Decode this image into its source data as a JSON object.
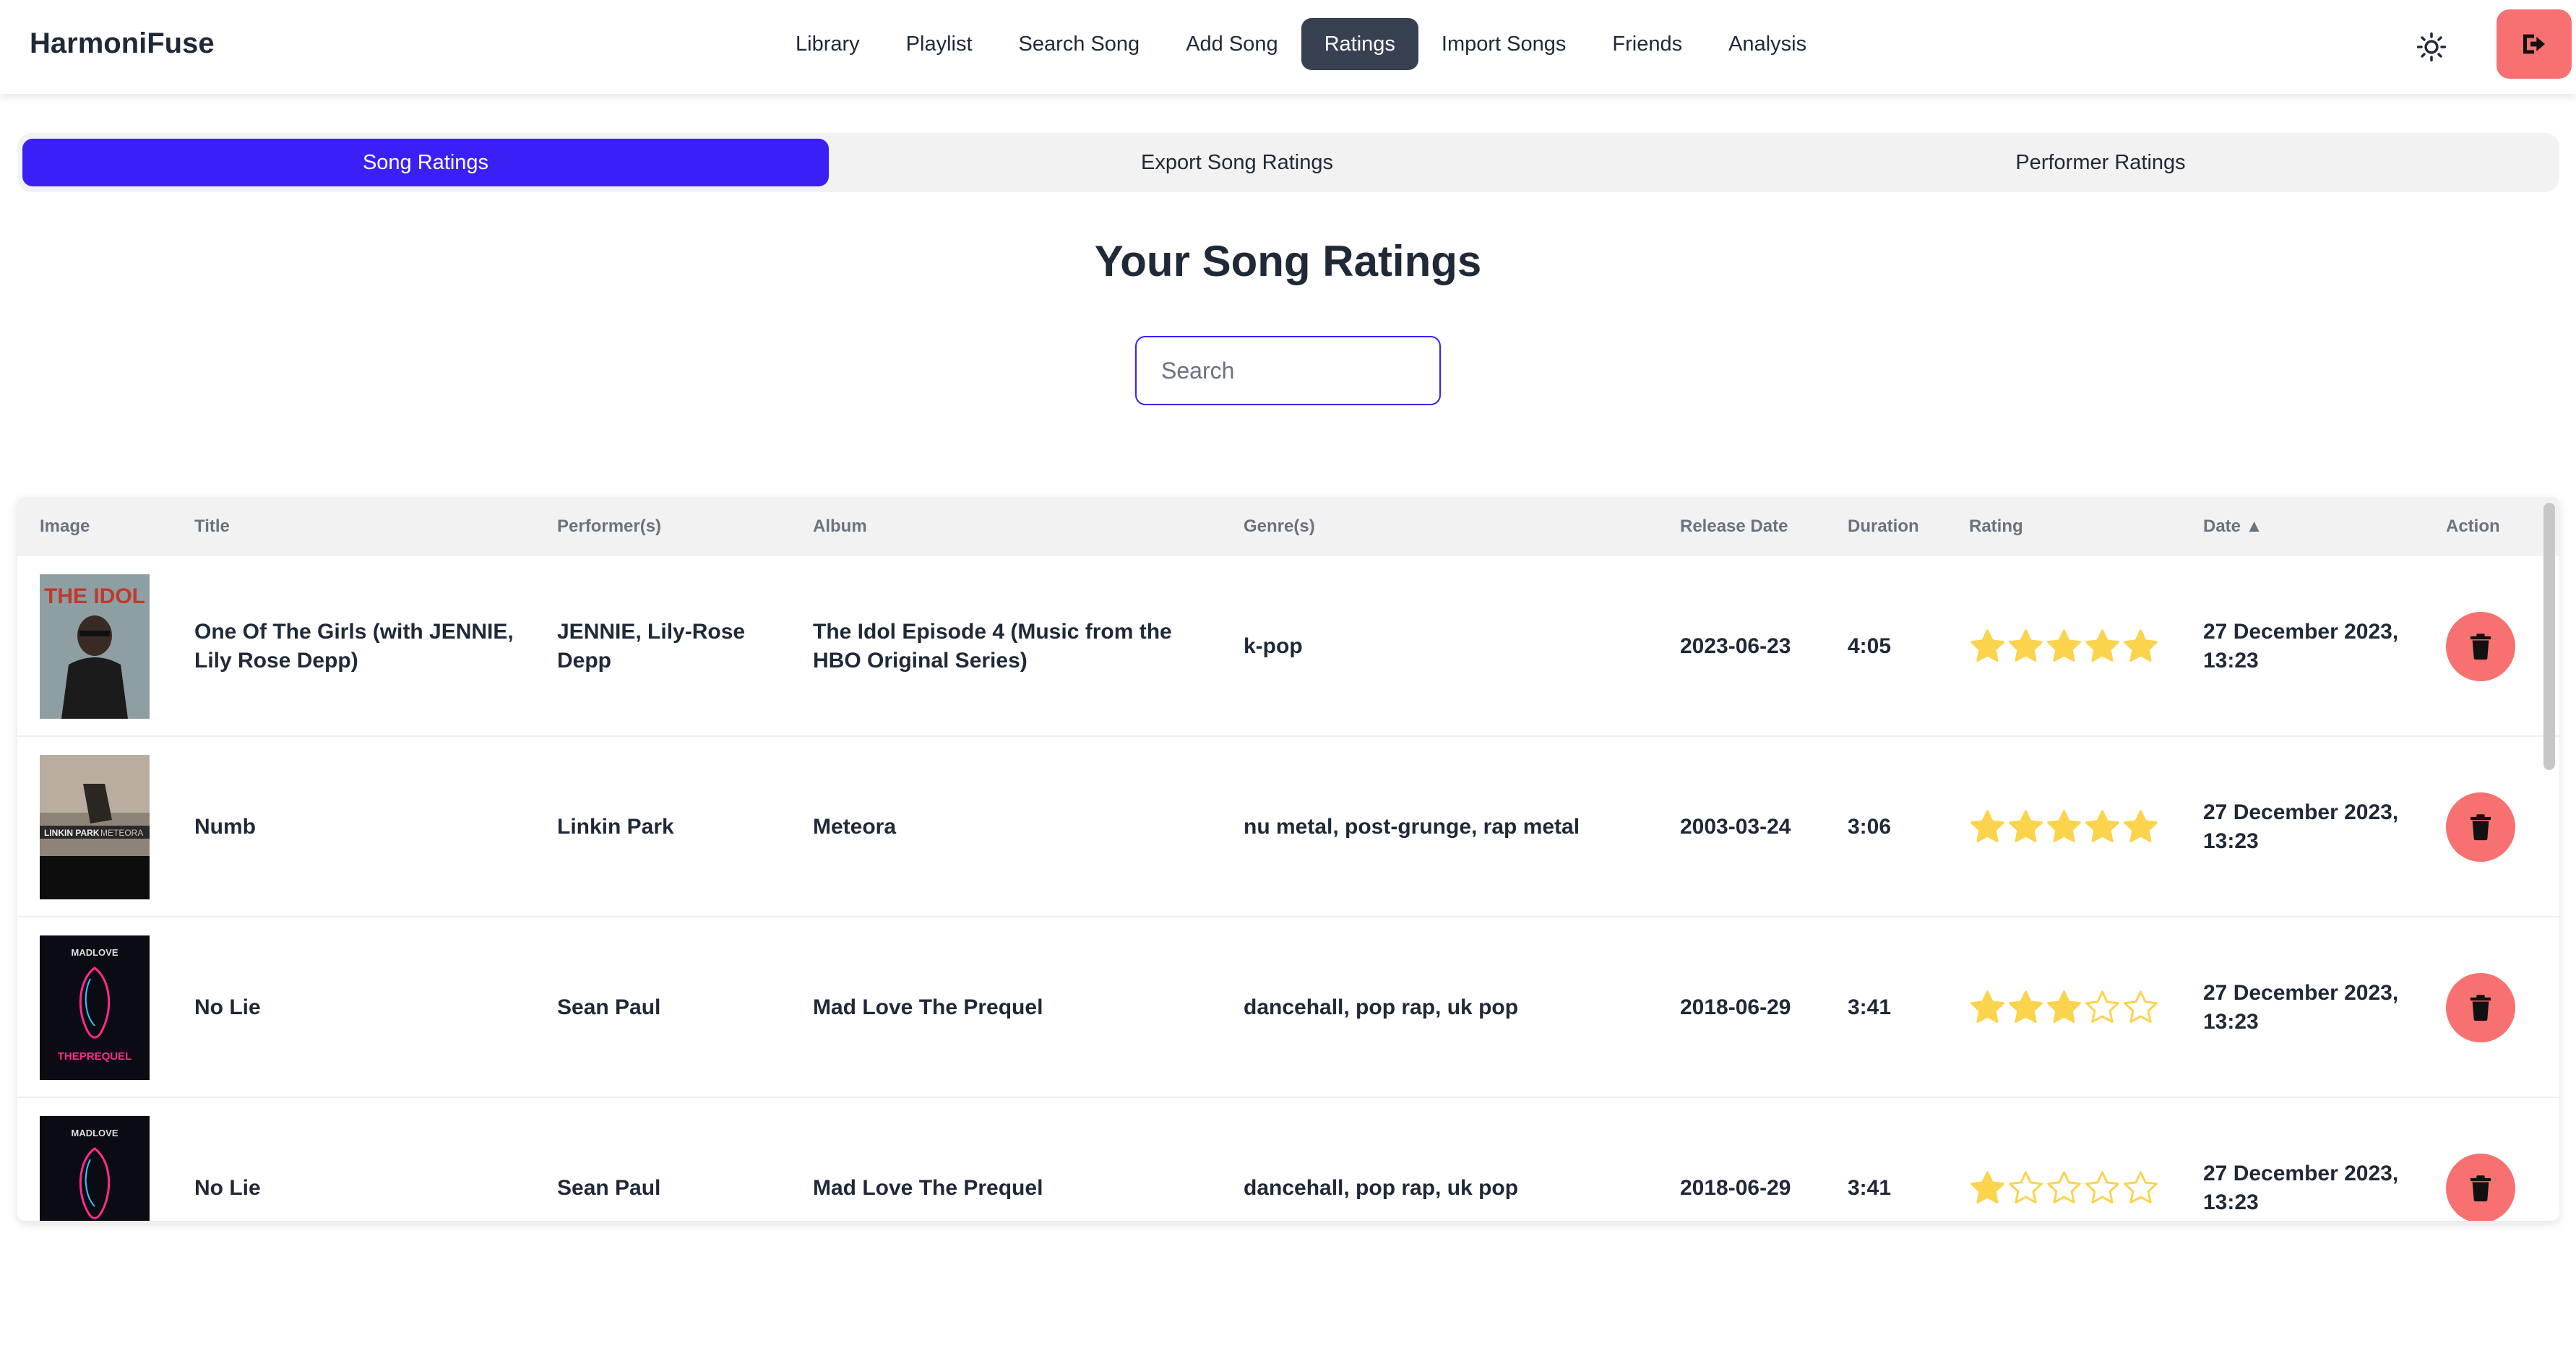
{
  "app": {
    "brand": "HarmoniFuse"
  },
  "nav": {
    "items": [
      {
        "label": "Library",
        "active": false
      },
      {
        "label": "Playlist",
        "active": false
      },
      {
        "label": "Search Song",
        "active": false
      },
      {
        "label": "Add Song",
        "active": false
      },
      {
        "label": "Ratings",
        "active": true
      },
      {
        "label": "Import Songs",
        "active": false
      },
      {
        "label": "Friends",
        "active": false
      },
      {
        "label": "Analysis",
        "active": false
      }
    ],
    "theme_icon": "sun-icon",
    "logout_icon": "logout-icon"
  },
  "tabs": [
    {
      "label": "Song Ratings",
      "active": true
    },
    {
      "label": "Export Song Ratings",
      "active": false
    },
    {
      "label": "Performer Ratings",
      "active": false
    }
  ],
  "page": {
    "title": "Your Song Ratings"
  },
  "search": {
    "placeholder": "Search",
    "value": ""
  },
  "table": {
    "columns": [
      "Image",
      "Title",
      "Performer(s)",
      "Album",
      "Genre(s)",
      "Release Date",
      "Duration",
      "Rating",
      "Date ▲",
      "Action"
    ],
    "rows": [
      {
        "title": "One Of The Girls (with JENNIE, Lily Rose Depp)",
        "performers": "JENNIE, Lily-Rose Depp",
        "album": "The Idol Episode 4 (Music from the HBO Original Series)",
        "genres": "k-pop",
        "release_date": "2023-06-23",
        "duration": "4:05",
        "rating": 5,
        "date": "27 December 2023, 13:23"
      },
      {
        "title": "Numb",
        "performers": "Linkin Park",
        "album": "Meteora",
        "genres": "nu metal, post-grunge, rap metal",
        "release_date": "2003-03-24",
        "duration": "3:06",
        "rating": 5,
        "date": "27 December 2023, 13:23"
      },
      {
        "title": "No Lie",
        "performers": "Sean Paul",
        "album": "Mad Love The Prequel",
        "genres": "dancehall, pop rap, uk pop",
        "release_date": "2018-06-29",
        "duration": "3:41",
        "rating": 3,
        "date": "27 December 2023, 13:23"
      },
      {
        "title": "No Lie",
        "performers": "Sean Paul",
        "album": "Mad Love The Prequel",
        "genres": "dancehall, pop rap, uk pop",
        "release_date": "2018-06-29",
        "duration": "3:41",
        "rating": 1,
        "date": "27 December 2023, 13:23"
      }
    ],
    "max_rating": 5,
    "star_color": "#fcd34d",
    "delete_icon": "trash-icon"
  },
  "colors": {
    "accent": "#3b1ff7",
    "danger": "#f87171",
    "nav_active": "#374151"
  }
}
